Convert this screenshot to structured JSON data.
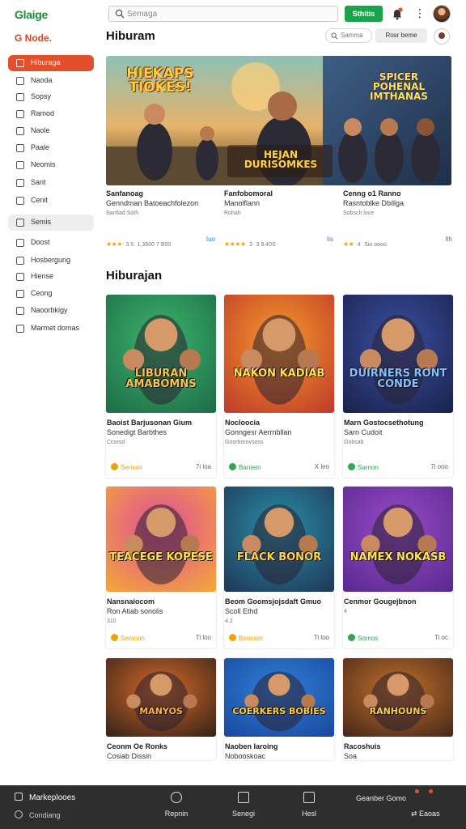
{
  "app": {
    "logo": "Glaige",
    "brand": "G Node."
  },
  "search": {
    "placeholder": "Semaga"
  },
  "header": {
    "cta_label": "Sthitis",
    "colors": {
      "accent": "#e2502b",
      "cta": "#1aa34a"
    }
  },
  "sidebar": {
    "items": [
      {
        "label": "Hiburaga",
        "state": "active"
      },
      {
        "label": "Naoda"
      },
      {
        "label": "Sopsy"
      },
      {
        "label": "Ramod"
      },
      {
        "label": "Naole"
      },
      {
        "label": "Paale"
      },
      {
        "label": "Neomis"
      },
      {
        "label": "Sarit"
      },
      {
        "label": "Cenit"
      },
      {
        "label": "Semis",
        "state": "soft"
      },
      {
        "label": "Doost"
      },
      {
        "label": "Hosbergung"
      },
      {
        "label": "Hiense"
      },
      {
        "label": "Ceong"
      },
      {
        "label": "Naoorbkigy"
      },
      {
        "label": "Marmet domas"
      }
    ]
  },
  "content": {
    "title": "Hiburam",
    "mini_search": "Samma",
    "pill": "Rosr beme",
    "section2_title": "Hiburajan"
  },
  "hero": {
    "captions": [
      "HIEKAPS TIOKES!",
      "HEJAN DURISOMKES",
      "SPICER POHENAL IMTHANAS"
    ],
    "items": [
      {
        "t1": "Sanfanoag",
        "t2": "Genndman Batoeachfolezon",
        "t3": "Sanfiad Soth",
        "rating": "3.5",
        "meta": "1,3500 7 B00",
        "badge": "Iuo"
      },
      {
        "t1": "Fanfobomoral",
        "t2": "Manolflann",
        "t3": "Rohah",
        "rating": "3",
        "meta": "3 8.40S",
        "badge": "Iis"
      },
      {
        "t1": "Cenng o1 Ranno",
        "t2": "Rasntoblke Dbillga",
        "t3": "Sobsch loce",
        "rating": "4",
        "meta": "Sio oooo",
        "badge": "Ilh"
      }
    ]
  },
  "cards": [
    {
      "caption": "LIBURAN AMABOMNS",
      "t1": "Baoist Barjusonan Gium",
      "t2": "Sonedigt Barbthes",
      "t3": "Ccorsd",
      "status": "Serioan",
      "status_color": "#f0a400",
      "right": "7i loa"
    },
    {
      "caption": "NAKON KADIAB",
      "t1": "Nocloocia",
      "t2": "Gonngesr Aerrnbllan",
      "t3": "Goorborovsoss",
      "status": "Baniern",
      "status_color": "#2fa84f",
      "right": "X leo"
    },
    {
      "caption": "DUIRNERS RONT CONDE",
      "t1": "Marn Gostocsethotung",
      "t2": "Sarn Cudoit",
      "t3": "Gobsab",
      "status": "Sarnon",
      "status_color": "#2fa84f",
      "right": "7i ooo"
    },
    {
      "caption": "TEACEGE KOPESE",
      "t1": "Nansnaiocom",
      "t2": "Ron Atiab sonolis",
      "t3": "310",
      "status": "Semnan",
      "status_color": "#f0a400",
      "right": "Ti loo"
    },
    {
      "caption": "FLACK BONOR",
      "t1": "Beom Goomsjojsdaft Gmuo",
      "t2": "Scoll Ethd",
      "t3": "4.2",
      "status": "Beonam",
      "status_color": "#f0a400",
      "right": "Ti loo"
    },
    {
      "caption": "NAMEX NOKASB",
      "t1": "Cenmor Gougejbnon",
      "t2": "",
      "t3": "4",
      "status": "Sornos",
      "status_color": "#2fa84f",
      "right": "Ti oc"
    },
    {
      "caption": "MANYOS",
      "t1": "Ceonm Oe Ronks",
      "t2": "Cosiab Dissin",
      "t3": "",
      "status": "",
      "status_color": "#f0a400",
      "right": ""
    },
    {
      "caption": "COERKERS BOBIES",
      "t1": "Naoben Iaroing",
      "t2": "Nobooskoac",
      "t3": "",
      "status": "",
      "status_color": "#f0a400",
      "right": ""
    },
    {
      "caption": "RANHOUNS",
      "t1": "Racoshuis",
      "t2": "Soa",
      "t3": "",
      "status": "",
      "status_color": "#f0a400",
      "right": ""
    }
  ],
  "bottom": {
    "brand": "Markeplooes",
    "sub": "Condiang",
    "tabs": [
      "Repnin",
      "Senegi",
      "Hesl"
    ],
    "right_top": "Geanber Gomo",
    "right_bottom": "Eaoas"
  }
}
